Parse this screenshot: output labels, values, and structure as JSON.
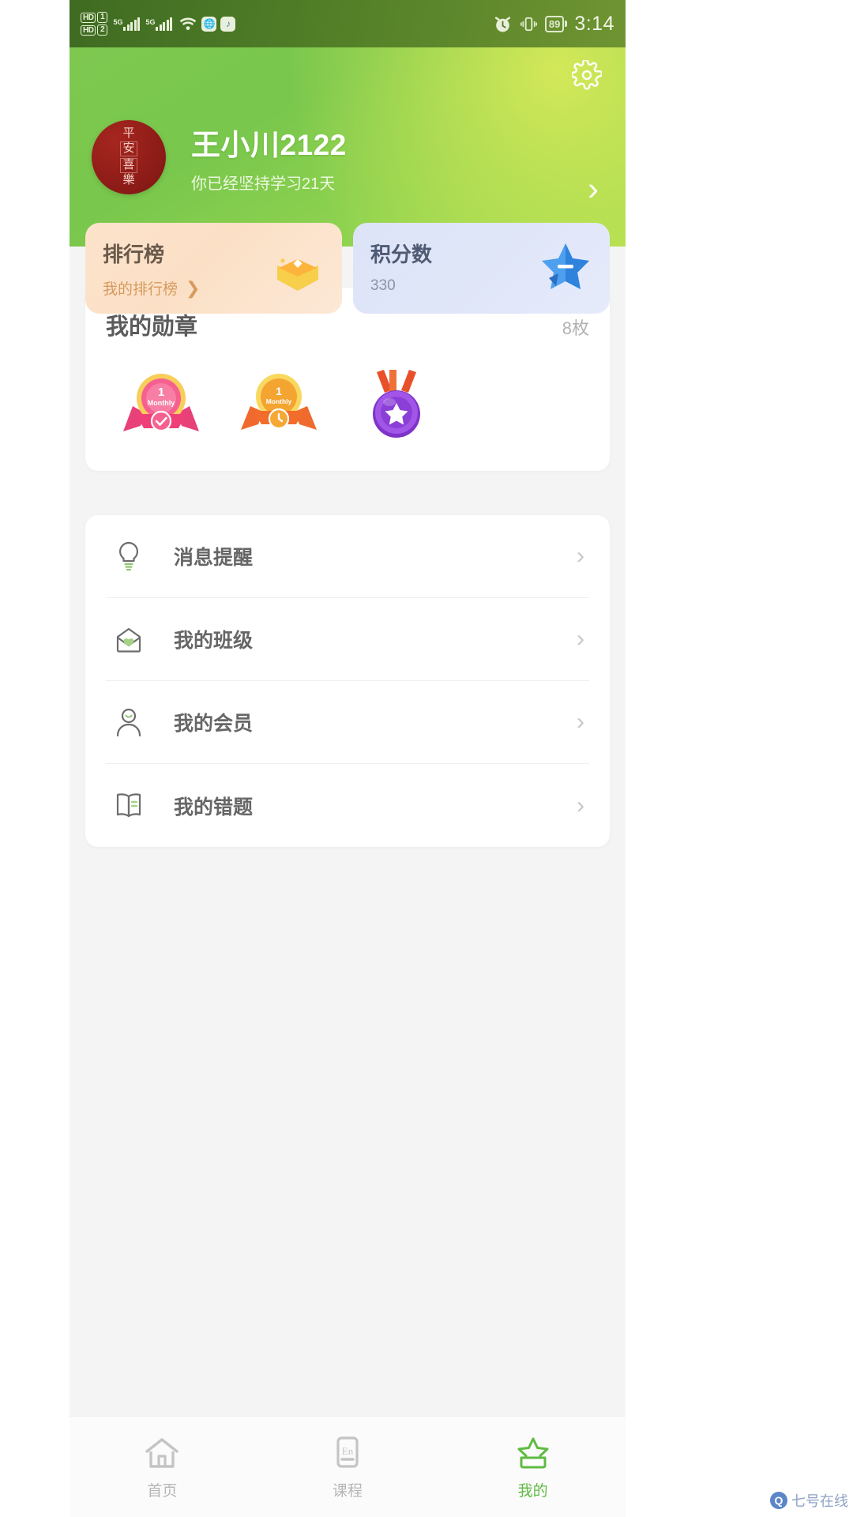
{
  "status_bar": {
    "hd1_label": "HD",
    "hd1_num": "1",
    "hd2_label": "HD",
    "hd2_num": "2",
    "net1": "5G",
    "net2": "5G",
    "wifi_icon": "wifi-icon",
    "app_icon_1": "globe-icon",
    "app_icon_2": "music-icon",
    "alarm_icon": "alarm-clock-icon",
    "vibrate_icon": "vibrate-icon",
    "battery_percent": "89",
    "time": "3:14"
  },
  "header": {
    "settings_icon": "gear-icon",
    "avatar": {
      "name": "avatar",
      "chars": [
        "平",
        "安",
        "喜",
        "樂"
      ]
    },
    "user_name": "王小川2122",
    "streak_text": "你已经坚持学习21天",
    "chevron": "›"
  },
  "stat_cards": [
    {
      "id": "ranking",
      "title": "排行榜",
      "subtitle": "我的排行榜",
      "chevron": "❯",
      "art_icon": "gift-box-icon",
      "bg_color": "#fbe0c6",
      "title_color": "#6a5a4b",
      "sub_color": "#d69a5e"
    },
    {
      "id": "points",
      "title": "积分数",
      "subtitle": "330",
      "chevron": "",
      "art_icon": "blue-star-icon",
      "bg_color": "#dde4f7",
      "title_color": "#4e5a73",
      "sub_color": "#8b93a8"
    }
  ],
  "medals": {
    "title": "我的勋章",
    "count_label": "8枚",
    "items": [
      {
        "name": "monthly-check-medal",
        "rank": "1",
        "caption": "Monthly",
        "color": "#f2507e"
      },
      {
        "name": "monthly-clock-medal",
        "rank": "1",
        "caption": "Monthly",
        "color": "#f2a33c"
      },
      {
        "name": "purple-star-medal",
        "rank": "",
        "caption": "",
        "color": "#9b4ddb"
      }
    ]
  },
  "menu": {
    "items": [
      {
        "label": "消息提醒",
        "icon": "lightbulb-icon",
        "chevron": "›"
      },
      {
        "label": "我的班级",
        "icon": "envelope-heart-icon",
        "chevron": "›"
      },
      {
        "label": "我的会员",
        "icon": "person-icon",
        "chevron": "›"
      },
      {
        "label": "我的错题",
        "icon": "open-book-icon",
        "chevron": "›"
      }
    ]
  },
  "tabbar": {
    "active_color": "#5fbb43",
    "inactive_color": "#b6b6b6",
    "tabs": [
      {
        "label": "首页",
        "icon": "home-icon",
        "active": false
      },
      {
        "label": "课程",
        "icon": "en-card-icon",
        "active": false
      },
      {
        "label": "我的",
        "icon": "star-graduation-icon",
        "active": true
      }
    ]
  },
  "watermark": {
    "badge": "Q",
    "text": "七号在线"
  }
}
